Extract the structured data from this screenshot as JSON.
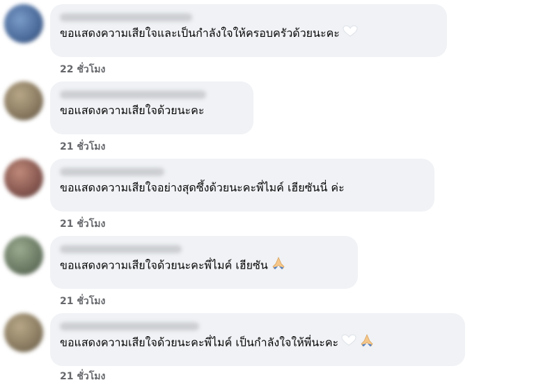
{
  "comments": [
    {
      "text": "ขอแสดงความเสียใจและเป็นกำลังใจให้ครอบครัวด้วยนะคะ",
      "time": "22 ชั่วโมง",
      "emojis": [
        "white-heart-icon"
      ],
      "avatar_color": "#4a6a9a"
    },
    {
      "text": "ขอแสดงความเสียใจด้วยนะคะ",
      "time": "21 ชั่วโมง",
      "emojis": [],
      "avatar_color": "#8c7c62"
    },
    {
      "text": "ขอแสดงความเสียใจอย่างสุดซึ้งด้วยนะคะพี่ไมค์ เฮียซันนี่ ค่ะ",
      "time": "21 ชั่วโมง",
      "emojis": [],
      "avatar_color": "#8a5a52"
    },
    {
      "text": "ขอแสดงความเสียใจด้วยนะคะพี่ไมค์ เฮียซัน",
      "time": "21 ชั่วโมง",
      "emojis": [
        "folded-hands-icon"
      ],
      "avatar_color": "#6d7d66"
    },
    {
      "text": "ขอแสดงความเสียใจด้วยนะคะพี่ไมค์ เป็นกำลังใจให้พี่นะคะ",
      "time": "21 ชั่วโมง",
      "emojis": [
        "white-heart-icon",
        "folded-hands-icon"
      ],
      "avatar_color": "#8d7e63"
    }
  ]
}
